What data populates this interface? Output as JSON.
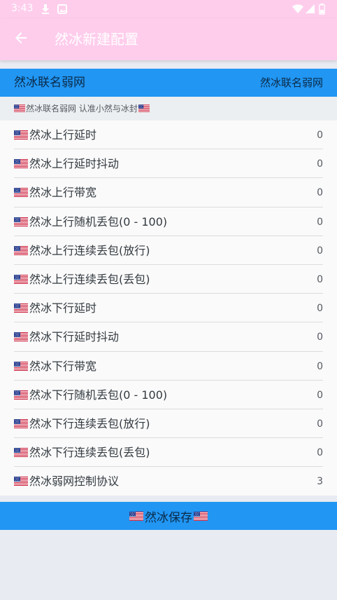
{
  "status_bar": {
    "time": "3:43",
    "icons": [
      "download-icon",
      "gallery-icon",
      "wifi-icon",
      "signal-icon",
      "battery-icon"
    ]
  },
  "app_bar": {
    "title": "然冰新建配置",
    "back_icon": "arrow-left-icon",
    "background_color": "#ffcdec"
  },
  "profile": {
    "left_label": "然冰联名弱网",
    "right_label": "然冰联名弱网",
    "background_color": "#2196f3"
  },
  "section_header": {
    "text": "然冰联名弱网 认准小然与冰封"
  },
  "settings": [
    {
      "label": "然冰上行延时",
      "value": "0"
    },
    {
      "label": "然冰上行延时抖动",
      "value": "0"
    },
    {
      "label": "然冰上行带宽",
      "value": "0"
    },
    {
      "label": "然冰上行随机丢包(0 - 100)",
      "value": "0"
    },
    {
      "label": "然冰上行连续丢包(放行)",
      "value": "0"
    },
    {
      "label": "然冰上行连续丢包(丢包)",
      "value": "0"
    },
    {
      "label": "然冰下行延时",
      "value": "0"
    },
    {
      "label": "然冰下行延时抖动",
      "value": "0"
    },
    {
      "label": "然冰下行带宽",
      "value": "0"
    },
    {
      "label": "然冰下行随机丢包(0 - 100)",
      "value": "0"
    },
    {
      "label": "然冰下行连续丢包(放行)",
      "value": "0"
    },
    {
      "label": "然冰下行连续丢包(丢包)",
      "value": "0"
    },
    {
      "label": "然冰弱网控制协议",
      "value": "3"
    }
  ],
  "save_button": {
    "label": "然冰保存"
  }
}
